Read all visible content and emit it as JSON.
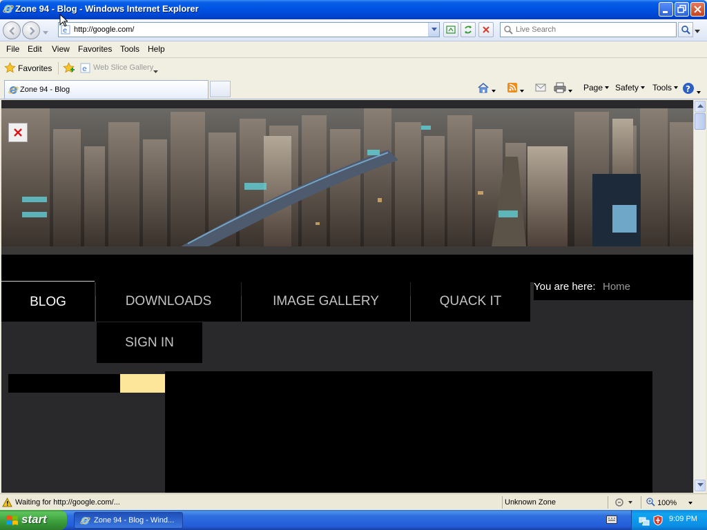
{
  "window": {
    "title": "Zone 94 - Blog - Windows Internet Explorer"
  },
  "navigation": {
    "url": "http://google.com/",
    "search_placeholder": "Live Search"
  },
  "menu": [
    "File",
    "Edit",
    "View",
    "Favorites",
    "Tools",
    "Help"
  ],
  "favorites_bar": {
    "favorites_label": "Favorites",
    "web_slice_label": "Web Slice Gallery"
  },
  "tab": {
    "title": "Zone 94 - Blog"
  },
  "command_bar": {
    "page": "Page",
    "safety": "Safety",
    "tools": "Tools"
  },
  "site": {
    "nav": [
      "BLOG",
      "DOWNLOADS",
      "IMAGE GALLERY",
      "QUACK IT",
      "SIGN IN"
    ],
    "breadcrumb_label": "You are here:",
    "breadcrumb_home": "Home",
    "colors": {
      "accent": "#fde59a",
      "background": "#29292b"
    }
  },
  "status": {
    "text": "Waiting for http://google.com/...",
    "zone": "Unknown Zone",
    "zoom": "100%"
  },
  "taskbar": {
    "start_label": "start",
    "task_label": "Zone 94 - Blog - Wind...",
    "clock": "9:09 PM"
  }
}
